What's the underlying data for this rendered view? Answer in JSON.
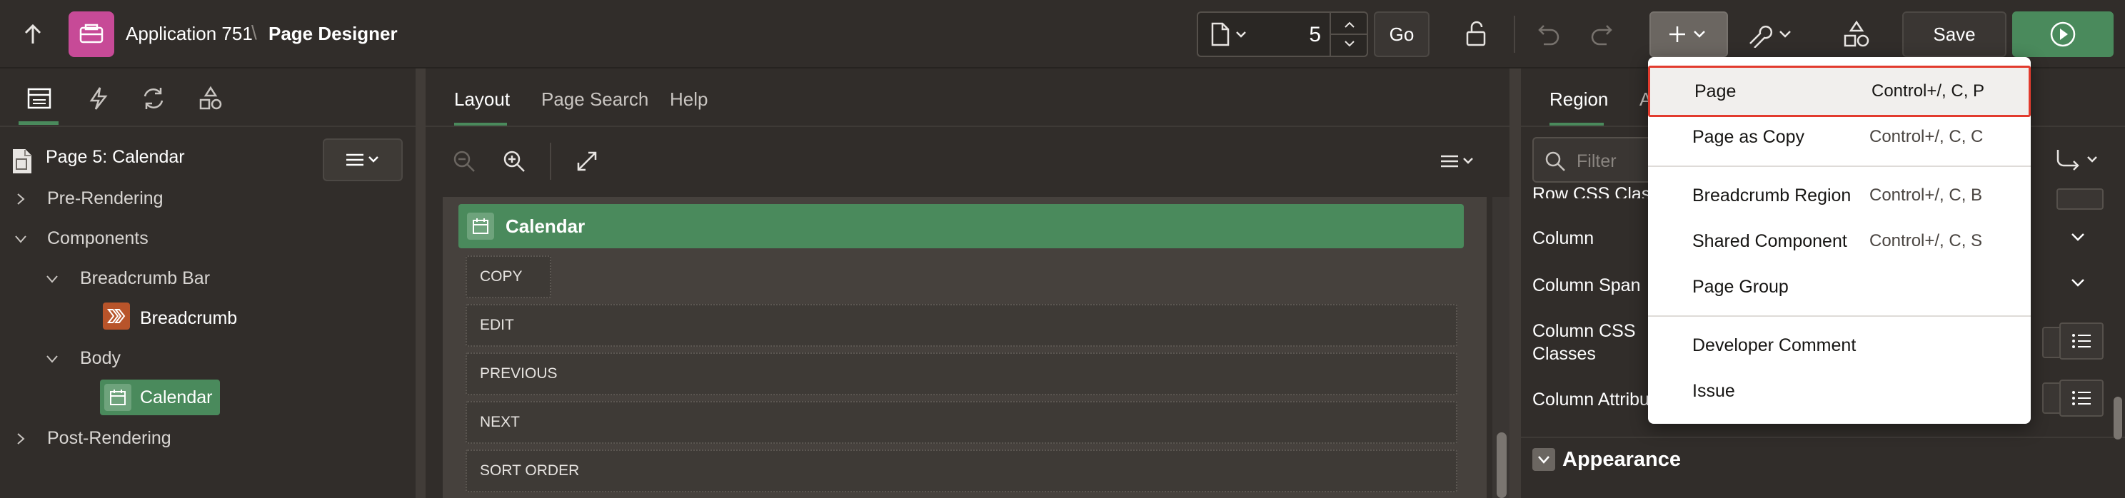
{
  "header": {
    "app_name": "Application 751",
    "separator": "\\",
    "page_name": "Page Designer",
    "page_number": "5",
    "go_label": "Go",
    "save_label": "Save"
  },
  "left": {
    "page_title": "Page 5: Calendar",
    "tree": {
      "pre_rendering": "Pre-Rendering",
      "components": "Components",
      "breadcrumb_bar": "Breadcrumb Bar",
      "breadcrumb": "Breadcrumb",
      "body": "Body",
      "calendar": "Calendar",
      "post_rendering": "Post-Rendering"
    }
  },
  "center": {
    "tabs": [
      "Layout",
      "Page Search",
      "Help"
    ],
    "region_title": "Calendar",
    "buttons": [
      "COPY",
      "EDIT",
      "PREVIOUS",
      "NEXT",
      "SORT ORDER"
    ]
  },
  "right": {
    "tabs": [
      "Region",
      "A"
    ],
    "filter_placeholder": "Filter",
    "props": {
      "row_css": "Row CSS Classes",
      "column": "Column",
      "column_span": "Column Span",
      "column_css_1": "Column CSS",
      "column_css_2": "Classes",
      "column_attr": "Column Attributes"
    },
    "section_appearance": "Appearance"
  },
  "menu": {
    "items": [
      {
        "label": "Page",
        "shortcut": "Control+/, C, P"
      },
      {
        "label": "Page as Copy",
        "shortcut": "Control+/, C, C"
      },
      {
        "label": "Breadcrumb Region",
        "shortcut": "Control+/, C, B"
      },
      {
        "label": "Shared Component",
        "shortcut": "Control+/, C, S"
      },
      {
        "label": "Page Group",
        "shortcut": ""
      },
      {
        "label": "Developer Comment",
        "shortcut": ""
      },
      {
        "label": "Issue",
        "shortcut": ""
      }
    ]
  },
  "colors": {
    "accent_green": "#4a8a5c",
    "app_pink": "#c74a97",
    "highlight_red": "#e23b2e",
    "bg_dark": "#312d2a"
  }
}
